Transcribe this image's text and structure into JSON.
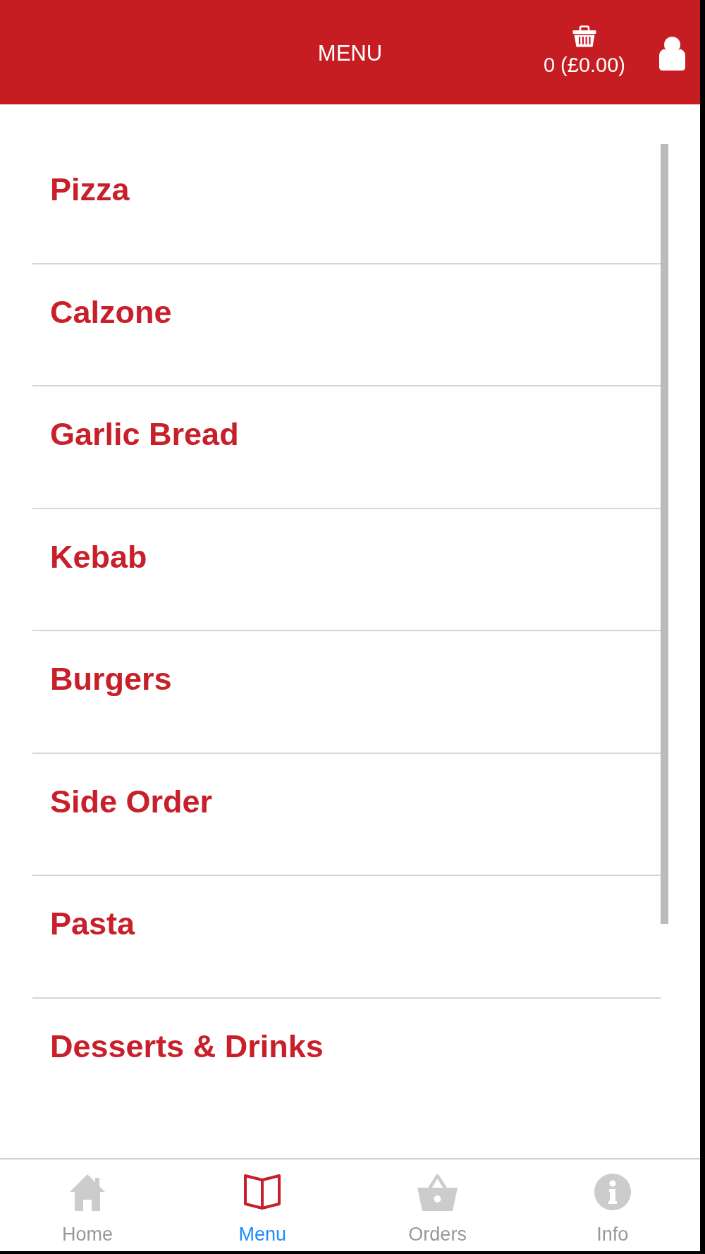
{
  "header": {
    "title": "MENU",
    "cart": {
      "summary": "0 (£0.00)"
    }
  },
  "categories": [
    {
      "label": "Pizza"
    },
    {
      "label": "Calzone"
    },
    {
      "label": "Garlic Bread"
    },
    {
      "label": "Kebab"
    },
    {
      "label": "Burgers"
    },
    {
      "label": "Side Order"
    },
    {
      "label": "Pasta"
    },
    {
      "label": "Desserts & Drinks"
    }
  ],
  "tab_bar": {
    "tabs": [
      {
        "kind": "home",
        "label": "Home",
        "selected": false
      },
      {
        "kind": "menu",
        "label": "Menu",
        "selected": true
      },
      {
        "kind": "orders",
        "label": "Orders",
        "selected": false
      },
      {
        "kind": "info",
        "label": "Info",
        "selected": false
      }
    ]
  }
}
